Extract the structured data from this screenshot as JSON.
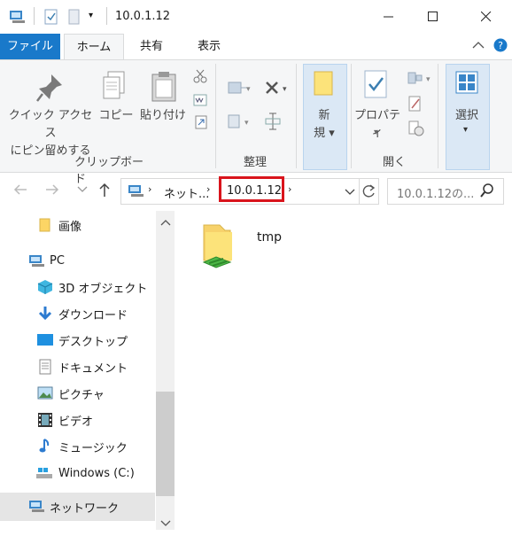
{
  "window": {
    "title": "10.0.1.12",
    "minimize_glyph": "—",
    "maximize_glyph": "☐",
    "close_glyph": "✕"
  },
  "ribbon_tabs": [
    {
      "label": "ファイル"
    },
    {
      "label": "ホーム"
    },
    {
      "label": "共有"
    },
    {
      "label": "表示"
    }
  ],
  "ribbon": {
    "clipboard": {
      "pin_label_line1": "クイック アクセス",
      "pin_label_line2": "にピン留めする",
      "copy_label": "コピー",
      "paste_label": "貼り付け",
      "group_label": "クリップボード"
    },
    "organize": {
      "group_label": "整理"
    },
    "new": {
      "label_line1": "新",
      "label_line2": "規"
    },
    "open": {
      "properties_label": "プロパティ",
      "group_label": "開く"
    },
    "select": {
      "label": "選択"
    }
  },
  "address": {
    "segments": [
      "ネット...",
      "10.0.1.12"
    ],
    "search_placeholder": "10.0.1.12の..."
  },
  "nav": {
    "items": [
      {
        "label": "画像"
      },
      {
        "label": "PC"
      },
      {
        "label": "3D オブジェクト"
      },
      {
        "label": "ダウンロード"
      },
      {
        "label": "デスクトップ"
      },
      {
        "label": "ドキュメント"
      },
      {
        "label": "ピクチャ"
      },
      {
        "label": "ビデオ"
      },
      {
        "label": "ミュージック"
      },
      {
        "label": "Windows (C:)"
      },
      {
        "label": "ネットワーク"
      }
    ]
  },
  "files": [
    {
      "name": "tmp",
      "icon": "shared-folder-icon"
    }
  ],
  "colors": {
    "file_tab": "#1979ca",
    "highlight": "#d9141c",
    "selected_nav": "#e5e5e5"
  }
}
